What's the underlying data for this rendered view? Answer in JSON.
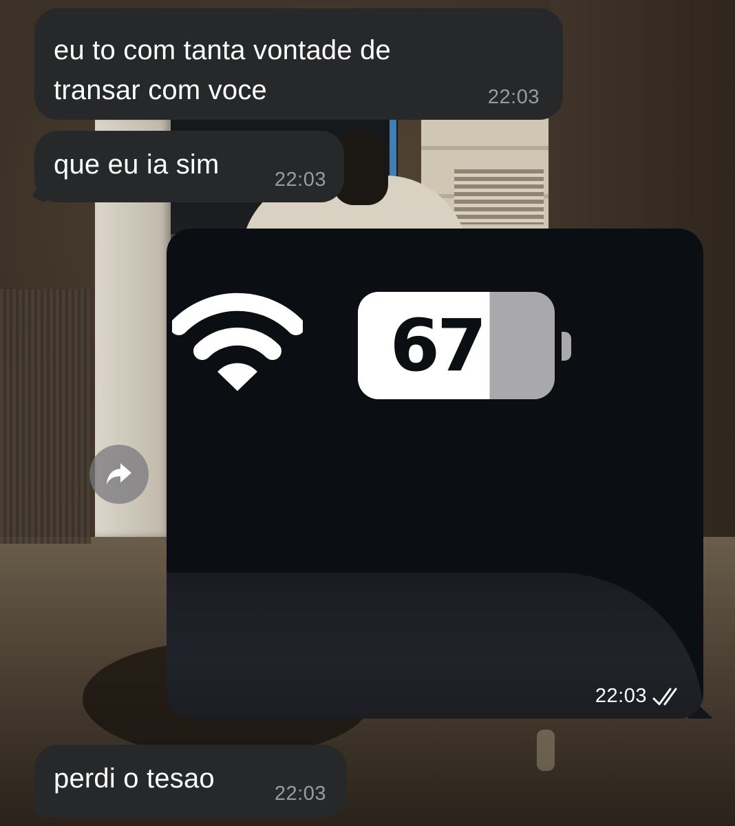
{
  "chat": {
    "messages": [
      {
        "text_line1": "eu to com tanta vontade de",
        "text_line2": "transar com voce",
        "time": "22:03",
        "direction": "incoming"
      },
      {
        "text": "que eu ia sim",
        "time": "22:03",
        "direction": "incoming"
      },
      {
        "type": "image",
        "battery_label": "67",
        "time": "22:03",
        "status": "read",
        "direction": "outgoing"
      },
      {
        "text": "perdi o tesao",
        "time": "22:03",
        "direction": "incoming"
      }
    ]
  },
  "colors": {
    "bubble_incoming": "#272829",
    "time_incoming": "#9a9b9d",
    "image_background": "#0b0e13",
    "read_check": "#8fb9ff"
  },
  "icons": {
    "forward": "forward-arrow-icon",
    "read_status": "double-check-icon",
    "wifi": "wifi-icon",
    "battery": "battery-icon"
  }
}
